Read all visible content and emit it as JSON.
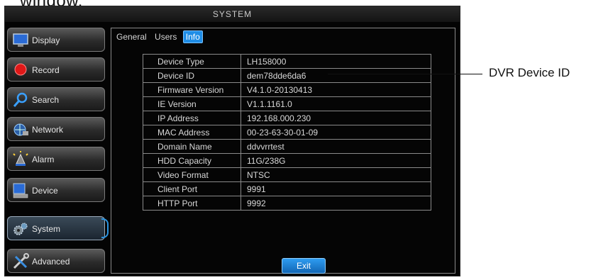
{
  "caption_top": "window.",
  "window": {
    "title": "SYSTEM"
  },
  "sidebar": {
    "items": [
      {
        "label": "Display",
        "icon": "monitor-icon"
      },
      {
        "label": "Record",
        "icon": "record-icon"
      },
      {
        "label": "Search",
        "icon": "search-icon"
      },
      {
        "label": "Network",
        "icon": "network-icon"
      },
      {
        "label": "Alarm",
        "icon": "alarm-icon"
      },
      {
        "label": "Device",
        "icon": "device-icon"
      },
      {
        "label": "System",
        "icon": "gear-icon",
        "active": true
      },
      {
        "label": "Advanced",
        "icon": "tools-icon"
      }
    ]
  },
  "tabs": [
    {
      "label": "General"
    },
    {
      "label": "Users"
    },
    {
      "label": "Info",
      "active": true
    }
  ],
  "info": {
    "rows": [
      {
        "key": "Device Type",
        "value": "LH158000"
      },
      {
        "key": "Device ID",
        "value": "dem78dde6da6"
      },
      {
        "key": "Firmware Version",
        "value": "V4.1.0-20130413"
      },
      {
        "key": "IE Version",
        "value": "V1.1.1161.0"
      },
      {
        "key": "IP Address",
        "value": "192.168.000.230"
      },
      {
        "key": "MAC Address",
        "value": "00-23-63-30-01-09"
      },
      {
        "key": "Domain Name",
        "value": "ddvvrrtest"
      },
      {
        "key": "HDD Capacity",
        "value": "11G/238G"
      },
      {
        "key": "Video Format",
        "value": "NTSC"
      },
      {
        "key": "Client Port",
        "value": "9991"
      },
      {
        "key": "HTTP Port",
        "value": "9992"
      }
    ]
  },
  "exit_label": "Exit",
  "callout_label": "DVR Device ID",
  "colors": {
    "accent": "#1f8de6",
    "screen_bg": "#040404",
    "record_red": "#e01818"
  }
}
